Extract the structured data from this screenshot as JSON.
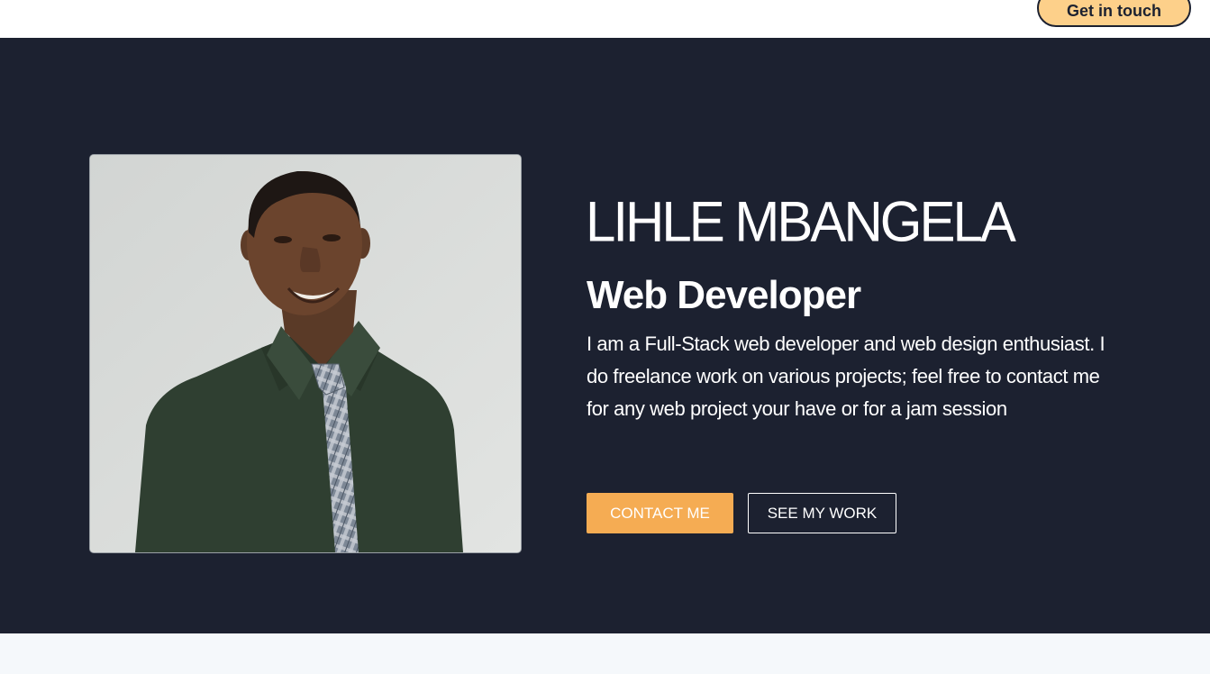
{
  "header": {
    "cta_label": "Get in touch"
  },
  "hero": {
    "name": "LIHLE MBANGELA",
    "role": "Web Developer",
    "bio": "I am a Full-Stack web developer and web design enthusiast. I do freelance work on various projects; feel free to contact me for any web project your have or for a jam session",
    "primary_button": "CONTACT ME",
    "secondary_button": "SEE MY WORK"
  },
  "colors": {
    "hero_background": "#1c2130",
    "accent": "#f5ac53",
    "header_cta_background": "#fdd08a",
    "page_background": "#f5f8fb"
  }
}
